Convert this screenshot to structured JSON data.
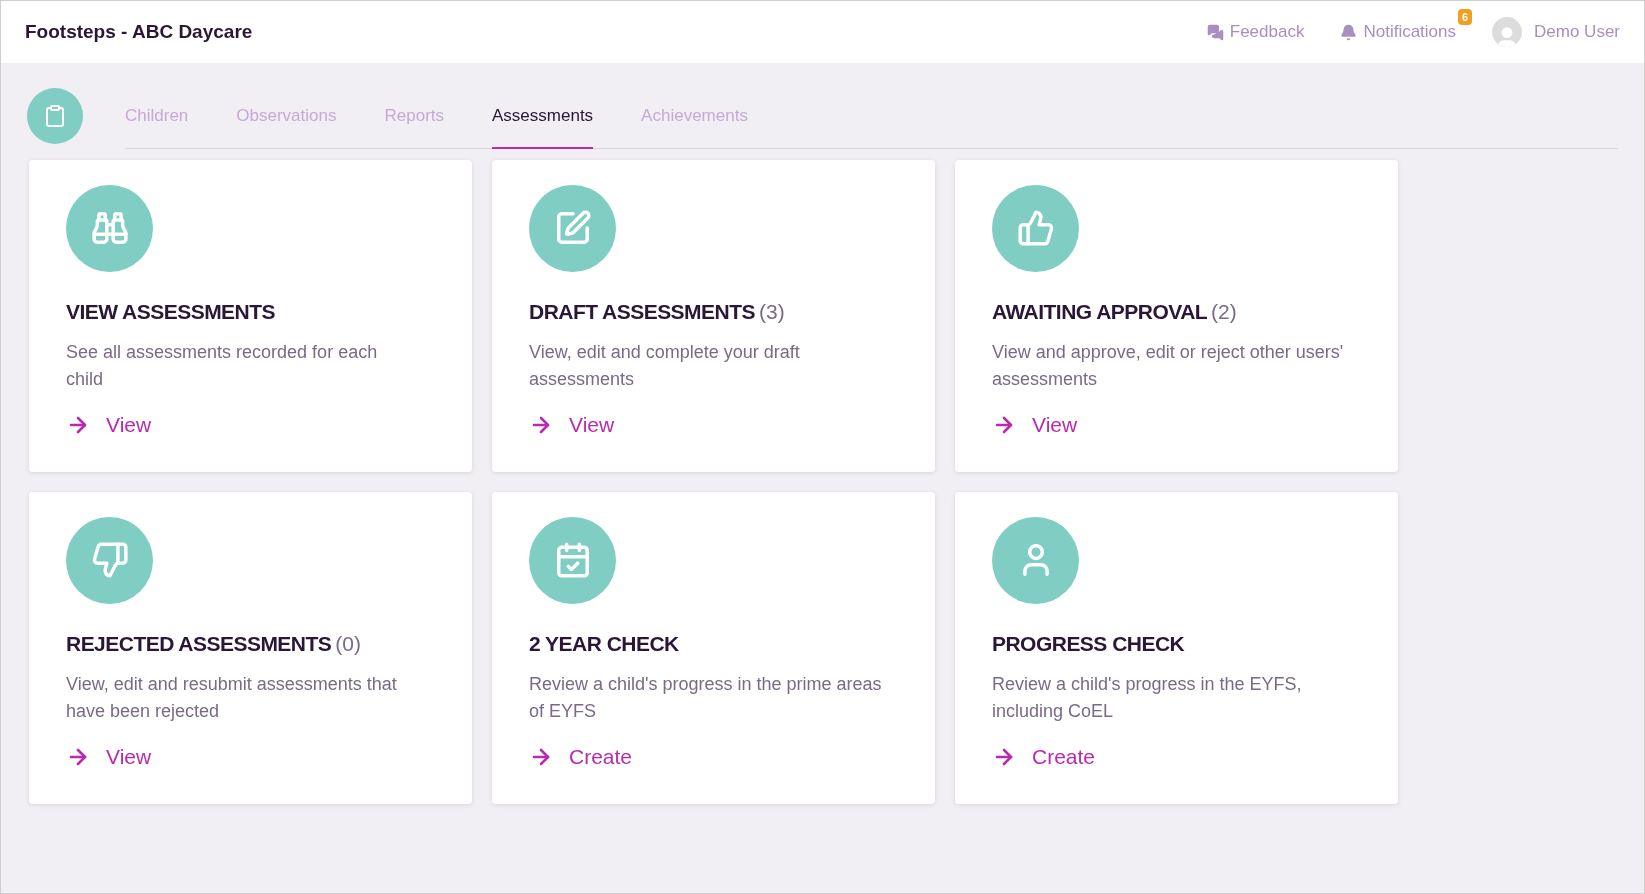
{
  "header": {
    "title": "Footsteps - ABC Daycare",
    "feedback": "Feedback",
    "notifications": {
      "label": "Notifications",
      "badge": "6"
    },
    "user": "Demo User"
  },
  "tabs": [
    {
      "label": "Children",
      "selected": false
    },
    {
      "label": "Observations",
      "selected": false
    },
    {
      "label": "Reports",
      "selected": false
    },
    {
      "label": "Assessments",
      "selected": true
    },
    {
      "label": "Achievements",
      "selected": false
    }
  ],
  "cards": [
    {
      "title": "VIEW ASSESSMENTS",
      "description": "See all assessments recorded for each child",
      "action": "View"
    },
    {
      "title": "DRAFT ASSESSMENTS",
      "count": "(3)",
      "description": "View, edit and complete your draft assessments",
      "action": "View"
    },
    {
      "title": "AWAITING APPROVAL",
      "count": "(2)",
      "description": "View and approve, edit or reject other users' assessments",
      "action": "View"
    },
    {
      "title": "REJECTED ASSESSMENTS",
      "count": "(0)",
      "description": "View, edit and resubmit assessments that have been rejected",
      "action": "View"
    },
    {
      "title": "2 YEAR CHECK",
      "description": "Review a child's progress in the prime areas of EYFS",
      "action": "Create"
    },
    {
      "title": "PROGRESS CHECK",
      "description": "Review a child's progress in the EYFS, including CoEL",
      "action": "Create"
    }
  ]
}
